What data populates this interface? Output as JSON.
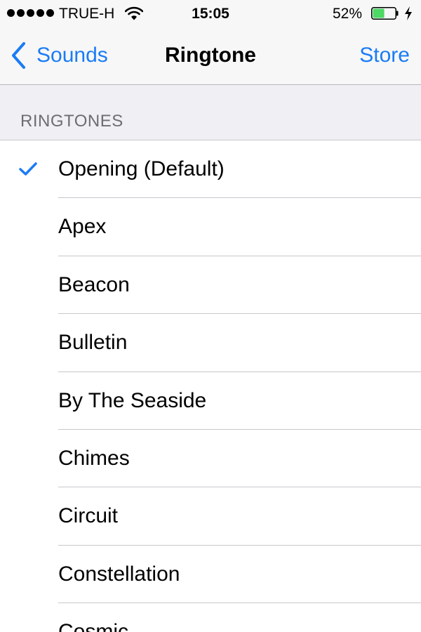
{
  "status_bar": {
    "carrier": "TRUE-H",
    "time": "15:05",
    "battery_percent": "52%",
    "battery_level": 0.52,
    "signal_bars": 5,
    "charging": true
  },
  "nav": {
    "back_label": "Sounds",
    "title": "Ringtone",
    "store_label": "Store"
  },
  "section": {
    "label": "RINGTONES"
  },
  "ringtones": [
    {
      "label": "Opening (Default)",
      "selected": true
    },
    {
      "label": "Apex",
      "selected": false
    },
    {
      "label": "Beacon",
      "selected": false
    },
    {
      "label": "Bulletin",
      "selected": false
    },
    {
      "label": "By The Seaside",
      "selected": false
    },
    {
      "label": "Chimes",
      "selected": false
    },
    {
      "label": "Circuit",
      "selected": false
    },
    {
      "label": "Constellation",
      "selected": false
    },
    {
      "label": "Cosmic",
      "selected": false
    }
  ],
  "colors": {
    "accent": "#1a7cf5",
    "battery_fill": "#4cd964",
    "bar_background": "#f7f7f7",
    "section_background": "#efeff4",
    "separator": "#c8c7cc"
  }
}
